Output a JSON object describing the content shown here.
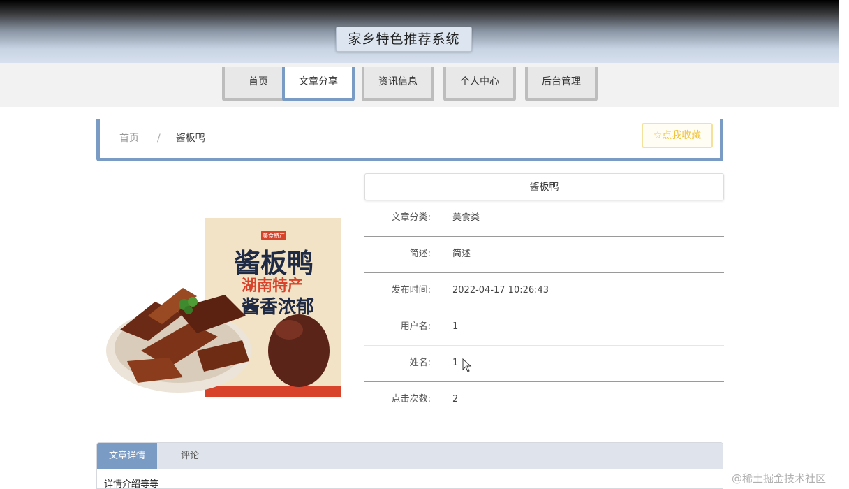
{
  "header": {
    "title": "家乡特色推荐系统"
  },
  "nav": [
    {
      "label": "首页",
      "active": false
    },
    {
      "label": "文章分享",
      "active": true
    },
    {
      "label": "资讯信息",
      "active": false
    },
    {
      "label": "个人中心",
      "active": false
    },
    {
      "label": "后台管理",
      "active": false
    }
  ],
  "breadcrumb": {
    "home": "首页",
    "separator": "/",
    "current": "酱板鸭"
  },
  "favorite_button": {
    "icon": "star-outline-icon",
    "label": "☆点我收藏"
  },
  "product_image": {
    "alt": "酱板鸭",
    "package_badge": "美食特产",
    "package_title": "酱板鸭",
    "package_subtitle": "湖南特产",
    "package_slogan": "酱香浓郁"
  },
  "detail": {
    "title": "酱板鸭",
    "rows": [
      {
        "label": "文章分类:",
        "value": "美食类"
      },
      {
        "label": "简述:",
        "value": "简述"
      },
      {
        "label": "发布时间:",
        "value": "2022-04-17 10:26:43"
      },
      {
        "label": "用户名:",
        "value": "1"
      },
      {
        "label": "姓名:",
        "value": "1"
      },
      {
        "label": "点击次数:",
        "value": "2"
      }
    ]
  },
  "tabs": [
    {
      "label": "文章详情",
      "active": true
    },
    {
      "label": "评论",
      "active": false
    }
  ],
  "tab_content": "详情介绍等等",
  "watermark": "@稀土掘金技术社区",
  "colors": {
    "accent": "#7a9bc4",
    "favorite": "#f0c33a"
  }
}
